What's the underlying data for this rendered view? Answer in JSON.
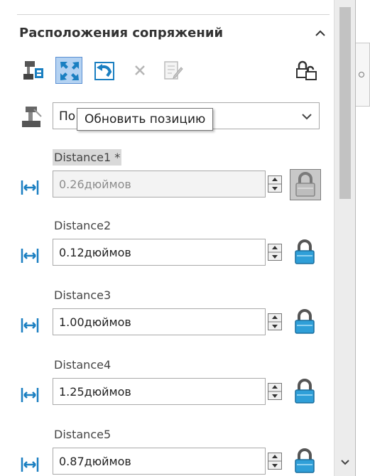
{
  "panel": {
    "title": "Расположения сопряжений",
    "collapse_icon": "chevron-up-icon"
  },
  "toolbar": {
    "buttons": [
      {
        "icon": "update-mate-icon",
        "active": false
      },
      {
        "icon": "update-position-icon",
        "active": true
      },
      {
        "icon": "undo-icon",
        "active": false
      },
      {
        "icon": "delete-icon",
        "active": false,
        "disabled": true
      },
      {
        "icon": "edit-icon",
        "active": false,
        "disabled": true
      },
      {
        "icon": "unlock-all-icon",
        "active": false
      }
    ]
  },
  "mode_select": {
    "value": "По",
    "icon": "mate-icon"
  },
  "tooltip": {
    "text": "Обновить позицию"
  },
  "mates": [
    {
      "label": "Distance1 *",
      "value": "0.26дюймов",
      "selected": true,
      "disabled": true,
      "locked": true
    },
    {
      "label": "Distance2",
      "value": "0.12дюймов",
      "selected": false,
      "disabled": false,
      "locked": true
    },
    {
      "label": "Distance3",
      "value": "1.00дюймов",
      "selected": false,
      "disabled": false,
      "locked": true
    },
    {
      "label": "Distance4",
      "value": "1.25дюймов",
      "selected": false,
      "disabled": false,
      "locked": true
    },
    {
      "label": "Distance5",
      "value": "0.87дюймов",
      "selected": false,
      "disabled": false,
      "locked": true
    }
  ],
  "colors": {
    "accent_blue": "#1a7fc1",
    "active_button_bg": "#b4d2f2",
    "lock_blue": "#2f9fd8",
    "text": "#222222"
  }
}
